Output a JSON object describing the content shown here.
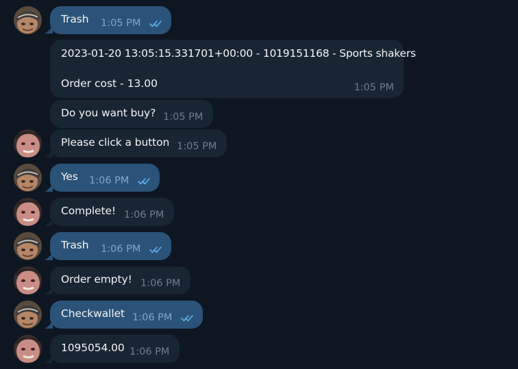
{
  "messages": [
    {
      "text": "Trash",
      "time": "1:05 PM",
      "direction": "outgoing",
      "status": "read-double-check-icon"
    },
    {
      "line1": "2023-01-20 13:05:15.331701+00:00 - 1019151168 - Sports shakers",
      "line2": "Order cost - 13.00",
      "time": "1:05 PM",
      "direction": "incoming"
    },
    {
      "text": "Do you want buy?",
      "time": "1:05 PM",
      "direction": "incoming"
    },
    {
      "text": "Please click a button",
      "time": "1:05 PM",
      "direction": "incoming"
    },
    {
      "text": "Yes",
      "time": "1:06 PM",
      "direction": "outgoing",
      "status": "read-double-check-icon"
    },
    {
      "text": "Complete!",
      "time": "1:06 PM",
      "direction": "incoming"
    },
    {
      "text": "Trash",
      "time": "1:06 PM",
      "direction": "outgoing",
      "status": "read-double-check-icon"
    },
    {
      "text": "Order empty!",
      "time": "1:06 PM",
      "direction": "incoming"
    },
    {
      "text": "Checkwallet",
      "time": "1:06 PM",
      "direction": "outgoing",
      "status": "read-double-check-icon"
    },
    {
      "text": "1095054.00",
      "time": "1:06 PM",
      "direction": "incoming"
    }
  ],
  "colors": {
    "background": "#0e1621",
    "outgoing_bubble": "#2b5278",
    "incoming_bubble": "#182533",
    "outgoing_time": "#7da8d3",
    "incoming_time": "#6d7f8f",
    "read_check": "#5fb4f0"
  }
}
